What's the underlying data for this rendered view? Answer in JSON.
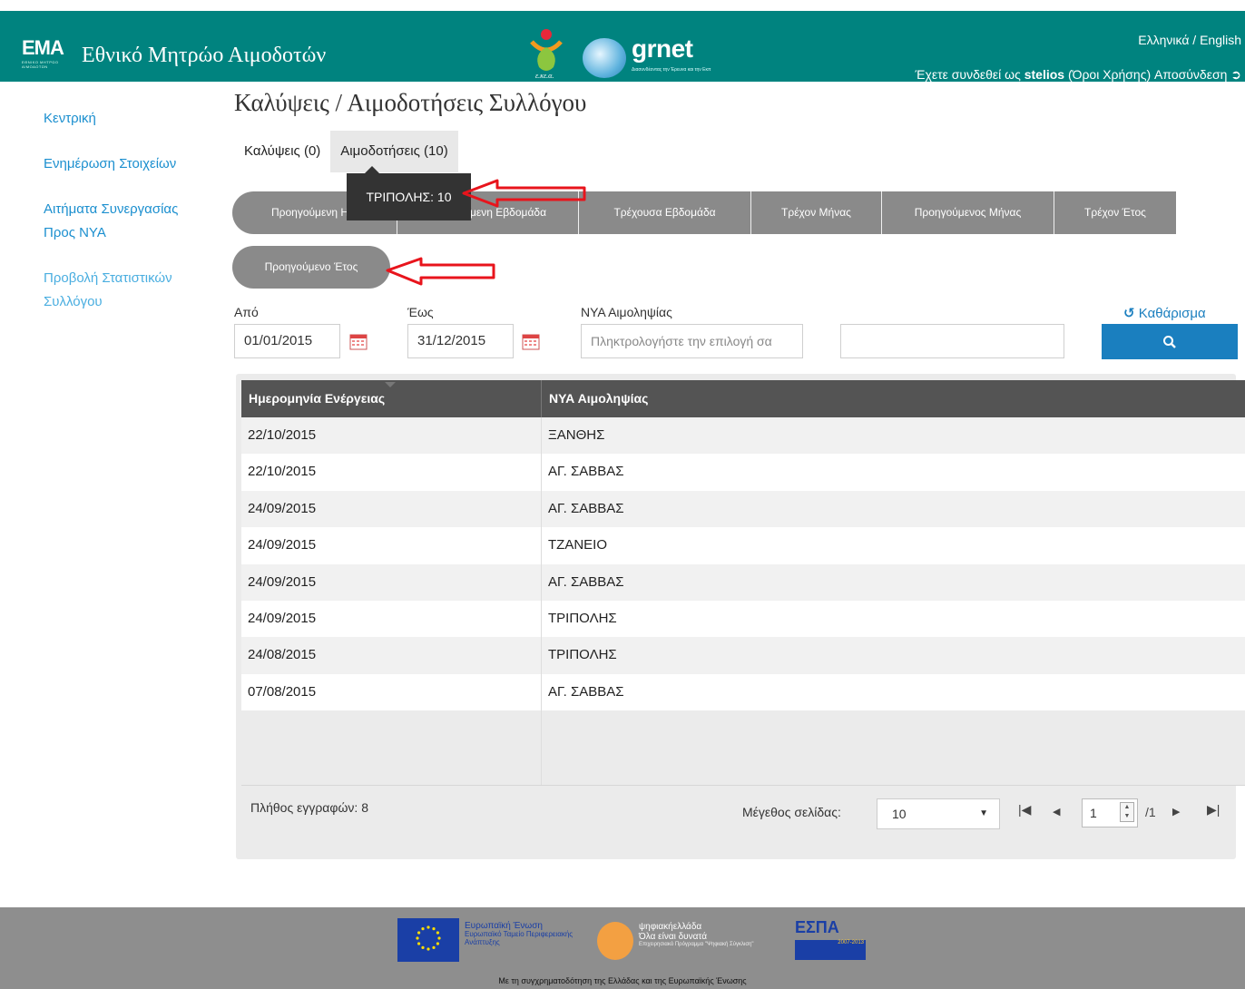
{
  "header": {
    "logo_text": "ΕΜΑ",
    "logo_sub": "ΕΘΝΙΚΟ ΜΗΤΡΩΟ ΑΙΜΟΔΟΤΩΝ",
    "site_title": "Εθνικό Μητρώο Αιμοδοτών",
    "ekea_label": "ε.κε.α.",
    "grnet_label": "grnet",
    "grnet_sub": "Διασυνδέοντας την Έρευνα και την Εκπ",
    "lang_switch": "Ελληνικά / English",
    "login_prefix": "Έχετε συνδεθεί ως",
    "username": "stelios",
    "terms_link": "(Όροι Χρήσης)",
    "logout_link": "Αποσύνδεση"
  },
  "sidebar": {
    "items": [
      {
        "label": "Κεντρική"
      },
      {
        "label": "Ενημέρωση Στοιχείων"
      },
      {
        "label": "Αιτήματα Συνεργασίας Προς ΝΥΑ"
      },
      {
        "label": "Προβολή Στατιστικών Συλλόγου"
      }
    ]
  },
  "main": {
    "page_title": "Καλύψεις / Αιμοδοτήσεις Συλλόγου",
    "tabs": [
      {
        "label": "Καλύψεις (0)"
      },
      {
        "label": "Αιμοδοτήσεις (10)"
      }
    ],
    "tooltip": "ΤΡΙΠΟΛΗΣ: 10",
    "period_buttons": [
      {
        "label": "Προηγούμενη Η"
      },
      {
        "label": "μενη Εβδομάδα"
      },
      {
        "label": "Τρέχουσα Εβδομάδα"
      },
      {
        "label": "Τρέχον Μήνας"
      },
      {
        "label": "Προηγούμενος Μήνας"
      },
      {
        "label": "Τρέχον Έτος"
      }
    ],
    "period_row2": "Προηγούμενο Έτος"
  },
  "filters": {
    "from_label": "Από",
    "from_value": "01/01/2015",
    "to_label": "Έως",
    "to_value": "31/12/2015",
    "nya_label": "ΝΥΑ Αιμοληψίας",
    "nya_placeholder": "Πληκτρολογήστε την επιλογή σα",
    "extra_value": "",
    "clear_label": "Καθάρισμα"
  },
  "grid": {
    "columns": [
      "Ημερομηνία Ενέργειας",
      "ΝΥΑ Αιμοληψίας"
    ],
    "rows": [
      [
        "22/10/2015",
        "ΞΑΝΘΗΣ"
      ],
      [
        "22/10/2015",
        "ΑΓ. ΣΑΒΒΑΣ"
      ],
      [
        "24/09/2015",
        "ΑΓ. ΣΑΒΒΑΣ"
      ],
      [
        "24/09/2015",
        "ΤΖΑΝΕΙΟ"
      ],
      [
        "24/09/2015",
        "ΑΓ. ΣΑΒΒΑΣ"
      ],
      [
        "24/09/2015",
        "ΤΡΙΠΟΛΗΣ"
      ],
      [
        "24/08/2015",
        "ΤΡΙΠΟΛΗΣ"
      ],
      [
        "07/08/2015",
        "ΑΓ. ΣΑΒΒΑΣ"
      ]
    ],
    "record_count": "Πλήθος εγγραφών: 8",
    "page_size_label": "Μέγεθος σελίδας:",
    "page_size": "10",
    "current_page": "1",
    "total_pages": "/1"
  },
  "footer": {
    "eu_title": "Ευρωπαϊκή Ένωση",
    "eu_fund": "Ευρωπαϊκό Ταμείο Περιφερειακής Ανάπτυξης",
    "digital_title": "ψηφιακήελλάδα",
    "digital_slogan": "Όλα είναι δυνατά",
    "digital_sub": "Επιχειρησιακό Πρόγραμμα \"Ψηφιακή Σύγκλιση\"",
    "espa_title": "ΕΣΠΑ",
    "espa_years": "2007-2013",
    "cofund_note": "Με τη συγχρηματοδότηση της Ελλάδας και της Ευρωπαϊκής Ένωσης"
  },
  "colors": {
    "header_bg": "#00837f",
    "link": "#1b8fcf",
    "period_btn": "#8a8a8a",
    "grid_header": "#545454",
    "search_btn": "#1a7fbf",
    "footer_bg": "#8e8e8e",
    "annotation_arrow": "#e8141c"
  },
  "icons": [
    "calendar-icon",
    "refresh-icon",
    "search-icon",
    "logout-icon",
    "first-page-icon",
    "prev-page-icon",
    "next-page-icon",
    "last-page-icon",
    "sort-icon"
  ]
}
